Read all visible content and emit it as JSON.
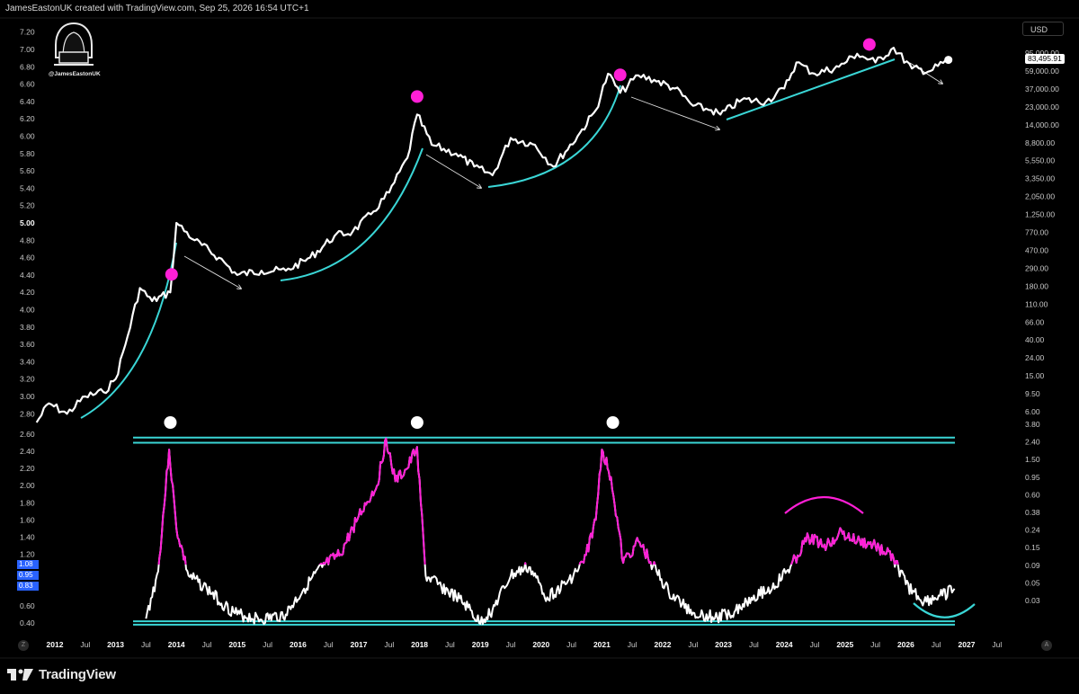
{
  "header": {
    "text": "JamesEastonUK created with TradingView.com, Sep 25, 2026 16:54 UTC+1"
  },
  "author": {
    "handle": "@JamesEastonUK",
    "icon": "hooded-hacker-icon"
  },
  "scale_button": {
    "label": "USD"
  },
  "current_price": {
    "label": "83,495.91"
  },
  "footer": {
    "brand": "TradingView",
    "icon": "tradingview-logo-icon"
  },
  "corner_buttons": {
    "left": "Z",
    "right": "A"
  },
  "colors": {
    "background": "#000000",
    "price_line": "#ffffff",
    "cyan": "#3ad6d6",
    "magenta": "#ff1fd6",
    "peak_marker": "#ff1fd6",
    "oscillator_marker": "#ffffff",
    "highlight_tag": "#2962ff"
  },
  "chart_data": [
    {
      "type": "line",
      "panel": "price",
      "x_ticks": [
        "2012",
        "Jul",
        "2013",
        "Jul",
        "2014",
        "Jul",
        "2015",
        "Jul",
        "2016",
        "Jul",
        "2017",
        "Jul",
        "2018",
        "Jul",
        "2019",
        "Jul",
        "2020",
        "Jul",
        "2021",
        "Jul",
        "2022",
        "Jul",
        "2023",
        "Jul",
        "2024",
        "Jul",
        "2025",
        "Jul",
        "2026",
        "Jul",
        "2027",
        "Jul"
      ],
      "left_axis_ticks": [
        "7.20",
        "7.00",
        "6.80",
        "6.60",
        "6.40",
        "6.20",
        "6.00",
        "5.80",
        "5.60",
        "5.40",
        "5.20",
        "5.00",
        "4.80",
        "4.60",
        "4.40",
        "4.20",
        "4.00",
        "3.80",
        "3.60",
        "3.40",
        "3.20",
        "3.00",
        "2.80"
      ],
      "left_axis_bold": "5.00",
      "right_axis_ticks": [
        "95,000.00",
        "59,000.00",
        "37,000.00",
        "23,000.00",
        "14,000.00",
        "8,800.00",
        "5,550.00",
        "3,350.00",
        "2,050.00",
        "1,250.00",
        "770.00",
        "470.00",
        "290.00",
        "180.00",
        "110.00",
        "66.00",
        "40.00",
        "24.00",
        "15.00",
        "9.50",
        "6.00"
      ],
      "scale": "log",
      "series": [
        {
          "x": [
            2011.7,
            2011.9,
            2012.2,
            2012.5,
            2012.8,
            2013.0,
            2013.2,
            2013.4,
            2013.6,
            2013.9,
            2014.0,
            2014.3,
            2014.7,
            2015.0,
            2015.4,
            2015.8,
            2016.2,
            2016.6,
            2016.9,
            2017.2,
            2017.5,
            2017.8,
            2017.96,
            2018.2,
            2018.6,
            2018.9,
            2019.2,
            2019.5,
            2019.9,
            2020.2,
            2020.6,
            2020.9,
            2021.1,
            2021.3,
            2021.6,
            2021.86,
            2022.2,
            2022.5,
            2022.8,
            2022.95,
            2023.3,
            2023.7,
            2024.0,
            2024.2,
            2024.5,
            2024.9,
            2025.2,
            2025.5,
            2025.8,
            2026.1,
            2026.4,
            2026.7
          ],
          "y": [
            2.7,
            2.92,
            2.8,
            3.0,
            3.05,
            3.2,
            3.7,
            4.25,
            4.1,
            4.2,
            5.0,
            4.8,
            4.6,
            4.4,
            4.45,
            4.45,
            4.6,
            4.85,
            4.9,
            5.1,
            5.35,
            5.75,
            6.25,
            5.9,
            5.8,
            5.65,
            5.55,
            5.98,
            5.9,
            5.65,
            6.0,
            6.3,
            6.72,
            6.5,
            6.7,
            6.65,
            6.55,
            6.35,
            6.3,
            6.25,
            6.42,
            6.4,
            6.55,
            6.85,
            6.72,
            6.8,
            6.95,
            6.85,
            7.02,
            6.78,
            6.75,
            6.88
          ]
        }
      ],
      "peaks": [
        2013.92,
        2017.96,
        2021.3,
        2025.4
      ],
      "trend_annotations": 9
    },
    {
      "type": "line",
      "panel": "oscillator",
      "left_axis_ticks": [
        "2.60",
        "2.40",
        "2.20",
        "2.00",
        "1.80",
        "1.60",
        "1.40",
        "1.20",
        "1.08",
        "0.95",
        "0.83",
        "0.60",
        "0.40"
      ],
      "highlighted_ticks": [
        "1.08",
        "0.95",
        "0.83"
      ],
      "right_axis_ticks": [
        "3.80",
        "2.40",
        "1.50",
        "0.95",
        "0.60",
        "0.38",
        "0.24",
        "0.15",
        "0.09",
        "0.05",
        "0.03"
      ],
      "bands": [
        {
          "name": "upper",
          "values": [
            2.56,
            2.5
          ]
        },
        {
          "name": "lower",
          "values": [
            0.42,
            0.38
          ]
        }
      ],
      "series": [
        {
          "x": [
            2013.5,
            2013.7,
            2013.88,
            2014.0,
            2014.2,
            2014.5,
            2014.8,
            2015.0,
            2015.4,
            2015.8,
            2016.1,
            2016.4,
            2016.7,
            2017.0,
            2017.3,
            2017.45,
            2017.6,
            2017.8,
            2017.96,
            2018.1,
            2018.3,
            2018.6,
            2018.8,
            2018.98,
            2019.2,
            2019.5,
            2019.8,
            2020.1,
            2020.4,
            2020.7,
            2020.9,
            2021.0,
            2021.15,
            2021.35,
            2021.6,
            2021.9,
            2022.1,
            2022.5,
            2022.9,
            2023.2,
            2023.5,
            2023.8,
            2024.1,
            2024.4,
            2024.7,
            2024.9,
            2025.2,
            2025.5,
            2025.8,
            2026.0,
            2026.3,
            2026.6,
            2026.8
          ],
          "y": [
            0.45,
            1.0,
            2.42,
            1.5,
            0.95,
            0.8,
            0.6,
            0.5,
            0.44,
            0.5,
            0.8,
            1.05,
            1.2,
            1.65,
            2.0,
            2.55,
            2.05,
            2.2,
            2.45,
            0.95,
            0.85,
            0.7,
            0.58,
            0.4,
            0.55,
            0.95,
            1.05,
            0.7,
            0.85,
            1.1,
            1.6,
            2.42,
            2.1,
            1.1,
            1.35,
            1.0,
            0.75,
            0.52,
            0.46,
            0.55,
            0.72,
            0.8,
            1.05,
            1.4,
            1.3,
            1.45,
            1.35,
            1.3,
            1.15,
            0.85,
            0.65,
            0.72,
            0.8
          ]
        }
      ],
      "markers": [
        2013.9,
        2017.96,
        2021.18
      ]
    }
  ]
}
